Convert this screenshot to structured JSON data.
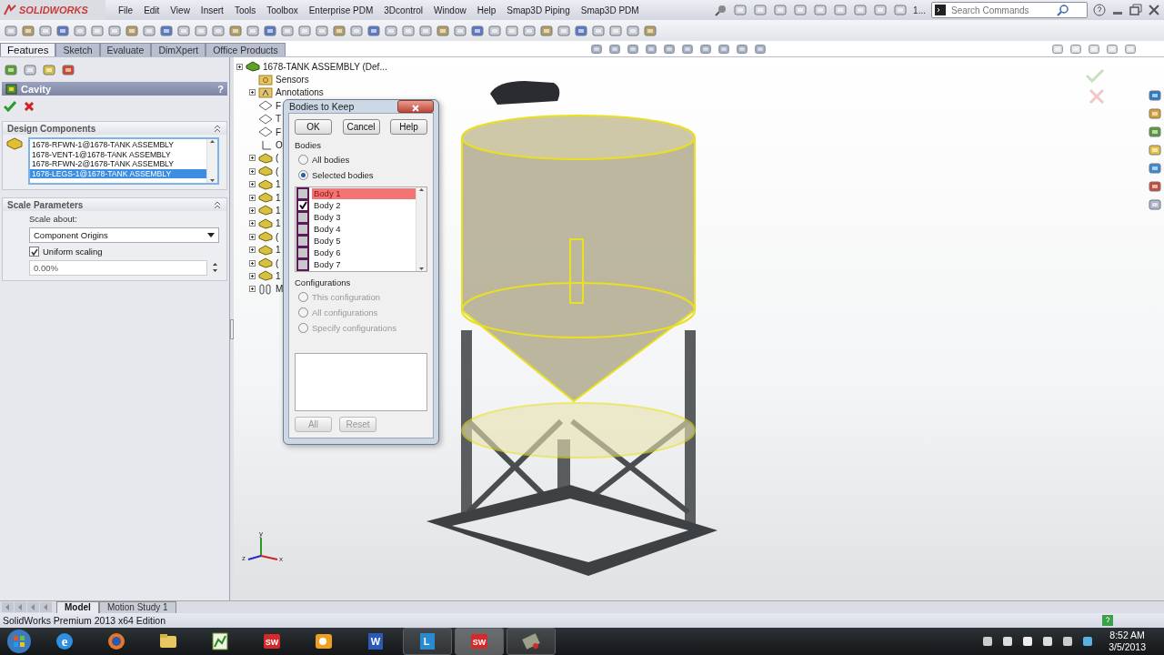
{
  "app": {
    "logo": "SOLIDWORKS",
    "menu": [
      "File",
      "Edit",
      "View",
      "Insert",
      "Tools",
      "Toolbox",
      "Enterprise PDM",
      "3Dcontrol",
      "Window",
      "Help",
      "Smap3D Piping",
      "Smap3D PDM"
    ],
    "recent": "1...",
    "search": {
      "placeholder": "Search Commands"
    }
  },
  "command_tabs": [
    {
      "label": "Features",
      "selected": true
    },
    {
      "label": "Sketch",
      "selected": false
    },
    {
      "label": "Evaluate",
      "selected": false
    },
    {
      "label": "DimXpert",
      "selected": false
    },
    {
      "label": "Office Products",
      "selected": false
    }
  ],
  "property_manager": {
    "title": "Cavity",
    "help": "?",
    "design_components": {
      "title": "Design Components",
      "items": [
        {
          "label": "1678-RFWN-1@1678-TANK ASSEMBLY",
          "selected": false
        },
        {
          "label": "1678-VENT-1@1678-TANK ASSEMBLY",
          "selected": false
        },
        {
          "label": "1678-RFWN-2@1678-TANK ASSEMBLY",
          "selected": false
        },
        {
          "label": "1678-LEGS-1@1678-TANK ASSEMBLY",
          "selected": true
        }
      ]
    },
    "scale_parameters": {
      "title": "Scale Parameters",
      "scale_about_label": "Scale about:",
      "scale_about": "Component Origins",
      "uniform_scaling": {
        "label": "Uniform scaling",
        "checked": true
      },
      "value": "0.00%"
    }
  },
  "tree": {
    "root": "1678-TANK ASSEMBLY  (Def...",
    "children": [
      {
        "kind": "sensors",
        "label": "Sensors",
        "expandable": false
      },
      {
        "kind": "annotations",
        "label": "Annotations",
        "expandable": true
      },
      {
        "kind": "plane",
        "label": "F",
        "expandable": false
      },
      {
        "kind": "plane",
        "label": "T",
        "expandable": false
      },
      {
        "kind": "plane",
        "label": "F",
        "expandable": false
      },
      {
        "kind": "origin",
        "label": "O",
        "expandable": false
      },
      {
        "kind": "component",
        "label": "(",
        "expandable": true
      },
      {
        "kind": "component",
        "label": "(",
        "expandable": true
      },
      {
        "kind": "component",
        "label": "1",
        "expandable": true
      },
      {
        "kind": "component",
        "label": "1",
        "expandable": true
      },
      {
        "kind": "component",
        "label": "1",
        "expandable": true
      },
      {
        "kind": "component",
        "label": "1",
        "expandable": true
      },
      {
        "kind": "component",
        "label": "(",
        "expandable": true
      },
      {
        "kind": "component",
        "label": "1",
        "expandable": true
      },
      {
        "kind": "component",
        "label": "(",
        "expandable": true
      },
      {
        "kind": "component",
        "label": "1",
        "expandable": true
      },
      {
        "kind": "mates",
        "label": "M",
        "expandable": true
      }
    ]
  },
  "dialog": {
    "title": "Bodies to Keep",
    "buttons": [
      "OK",
      "Cancel",
      "Help"
    ],
    "bodies_label": "Bodies",
    "body_options": [
      {
        "label": "All bodies",
        "selected": false
      },
      {
        "label": "Selected bodies",
        "selected": true
      }
    ],
    "bodies": [
      {
        "label": "Body  1",
        "checked": false,
        "selected": true
      },
      {
        "label": "Body  2",
        "checked": true,
        "selected": false
      },
      {
        "label": "Body  3",
        "checked": false,
        "selected": false
      },
      {
        "label": "Body  4",
        "checked": false,
        "selected": false
      },
      {
        "label": "Body  5",
        "checked": false,
        "selected": false
      },
      {
        "label": "Body  6",
        "checked": false,
        "selected": false
      },
      {
        "label": "Body  7",
        "checked": false,
        "selected": false
      }
    ],
    "configurations_label": "Configurations",
    "configuration_options": [
      {
        "label": "This configuration",
        "selected": false,
        "disabled": true
      },
      {
        "label": "All configurations",
        "selected": false,
        "disabled": true
      },
      {
        "label": "Specify configurations",
        "selected": false,
        "disabled": true
      }
    ],
    "bottom_buttons": [
      {
        "label": "All",
        "disabled": true
      },
      {
        "label": "Reset",
        "disabled": true
      }
    ]
  },
  "triad": {
    "y": "y",
    "z": "z",
    "x": "x"
  },
  "bottom_tabs": [
    {
      "label": "Model",
      "selected": true
    },
    {
      "label": "Motion Study 1",
      "selected": false
    }
  ],
  "status_bar": {
    "text": "SolidWorks Premium 2013 x64 Edition"
  },
  "taskbar": {
    "apps": [
      {
        "kind": "browser-e",
        "label": "e",
        "running": false,
        "selected": false
      },
      {
        "kind": "globe",
        "running": false,
        "selected": false
      },
      {
        "kind": "folder",
        "running": false,
        "selected": false
      },
      {
        "kind": "chart",
        "running": false,
        "selected": false
      },
      {
        "kind": "cube",
        "label": "SW",
        "running": false,
        "selected": false
      },
      {
        "kind": "mail",
        "running": false,
        "selected": false
      },
      {
        "kind": "doc",
        "label": "W",
        "running": false,
        "selected": false
      },
      {
        "kind": "chat",
        "label": "L",
        "running": true,
        "selected": false
      },
      {
        "kind": "cube",
        "label": "SW",
        "running": true,
        "selected": true
      },
      {
        "kind": "tool",
        "running": true,
        "selected": false
      }
    ],
    "time": "8:52 AM",
    "date": "3/5/2013"
  }
}
